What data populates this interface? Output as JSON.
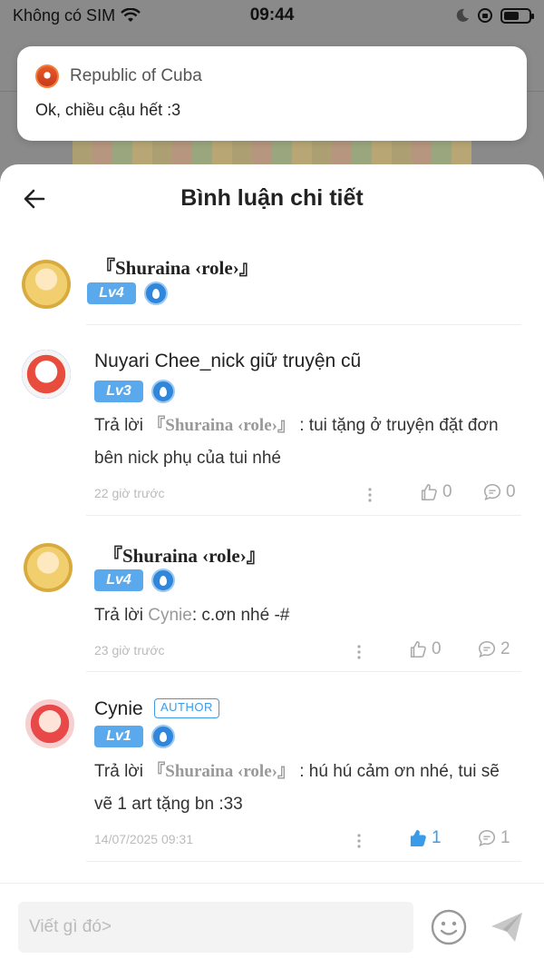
{
  "status_bar": {
    "carrier": "Không có SIM",
    "time": "09:44",
    "battery_level": 0.6
  },
  "notification": {
    "app_name": "Republic of Cuba",
    "message": "Ok, chiều cậu hết :3"
  },
  "sheet": {
    "title": "Bình luận chi tiết"
  },
  "comments": [
    {
      "name": "『Shuraina ‹role›』",
      "level": "Lv4"
    },
    {
      "name": "Nuyari Chee_nick giữ truyện cũ",
      "level": "Lv3",
      "reply_prefix": "Trả lời",
      "reply_to": "『Shuraina ‹role›』",
      "text": ": tui tặng ở truyện đặt đơn bên nick phụ của tui nhé",
      "time": "22 giờ trước",
      "likes": "0",
      "replies": "0"
    },
    {
      "name": "『Shuraina ‹role›』",
      "level": "Lv4",
      "reply_prefix": "Trả lời",
      "reply_to": "Cynie",
      "text": ": c.ơn nhé -#",
      "time": "23 giờ trước",
      "likes": "0",
      "replies": "2"
    },
    {
      "name": "Cynie",
      "author_tag": "AUTHOR",
      "level": "Lv1",
      "reply_prefix": "Trả lời",
      "reply_to": "『Shuraina ‹role›』",
      "text": ": hú hú cảm ơn nhé, tui sẽ vẽ 1 art tặng bn :33",
      "time": "14/07/2025 09:31",
      "likes": "1",
      "replies": "1",
      "liked": true
    }
  ],
  "footer": {
    "input_placeholder": "Viết gì đó>",
    "input_value": ""
  },
  "icons": {
    "wifi": "wifi-icon",
    "moon": "moon-icon",
    "orientation-lock": "orientation-lock-icon",
    "battery": "battery-icon",
    "back": "back-arrow-icon",
    "level-badge": "drop-badge-icon",
    "more": "more-vertical-icon",
    "like": "thumbs-up-icon",
    "reply": "chat-bubble-icon",
    "emoji": "smiley-icon",
    "send": "send-icon"
  },
  "colors": {
    "accent": "#3a9be8",
    "level_badge": "#5aa9ec",
    "overlay": "#8a8a8a"
  }
}
